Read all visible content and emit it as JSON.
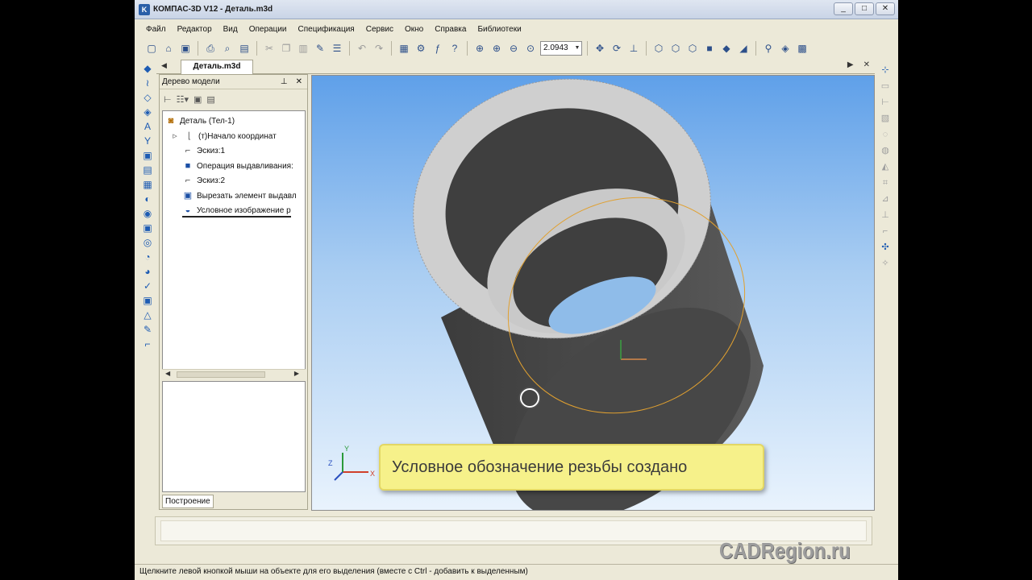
{
  "window": {
    "title": "КОМПАС-3D V12 - Деталь.m3d",
    "controls": [
      "_",
      "□",
      "✕"
    ]
  },
  "menu": [
    "Файл",
    "Редактор",
    "Вид",
    "Операции",
    "Спецификация",
    "Сервис",
    "Окно",
    "Справка",
    "Библиотеки"
  ],
  "toolbar": {
    "zoom_value": "2.0943"
  },
  "doc_tab": {
    "label": "Деталь.m3d"
  },
  "model_tree": {
    "header": "Дерево модели",
    "items": [
      {
        "label": "Деталь (Тел-1)",
        "icon": "part-icon"
      },
      {
        "label": "(т)Начало координат",
        "icon": "origin-icon"
      },
      {
        "label": "Эскиз:1",
        "icon": "sketch-icon"
      },
      {
        "label": "Операция выдавливания:",
        "icon": "extrude-icon"
      },
      {
        "label": "Эскиз:2",
        "icon": "sketch-icon"
      },
      {
        "label": "Вырезать элемент выдавл",
        "icon": "cut-icon"
      },
      {
        "label": "Условное изображение р",
        "icon": "thread-icon"
      }
    ],
    "bottom_tab": "Построение"
  },
  "viewport": {
    "notice": "Условное обозначение резьбы создано",
    "axis_labels": {
      "x": "X",
      "y": "Y",
      "z": "Z"
    }
  },
  "status_bar": {
    "text": "Щелкните левой кнопкой мыши на объекте для его выделения (вместе с Ctrl - добавить к выделенным)"
  },
  "watermark": "CADRegion.ru",
  "colors": {
    "accent": "#1e5cb3",
    "notice_bg": "#f6f18a",
    "cylinder_body": "#4b4b4b",
    "cylinder_face": "#cfcfcf",
    "thread_line": "#e0a030"
  }
}
